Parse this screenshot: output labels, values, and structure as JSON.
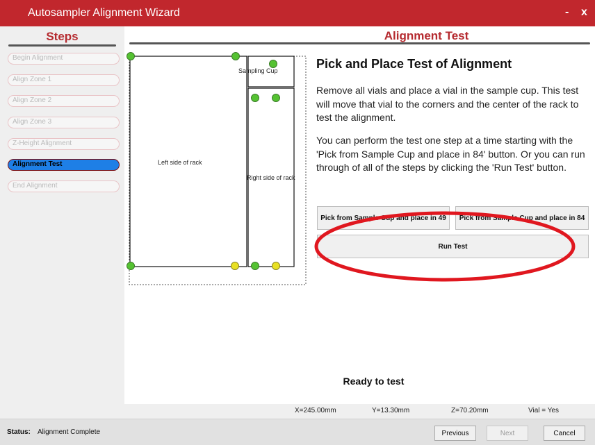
{
  "window": {
    "title": "Autosampler Alignment Wizard",
    "minimize_label": "-",
    "close_label": "x"
  },
  "sidebar": {
    "heading": "Steps",
    "items": [
      {
        "label": "Begin Alignment",
        "active": false
      },
      {
        "label": "Align Zone 1",
        "active": false
      },
      {
        "label": "Align Zone 2",
        "active": false
      },
      {
        "label": "Align Zone 3",
        "active": false
      },
      {
        "label": "Z-Height Alignment",
        "active": false
      },
      {
        "label": "Alignment Test",
        "active": true
      },
      {
        "label": "End Alignment",
        "active": false
      }
    ]
  },
  "main": {
    "heading": "Alignment Test",
    "rack": {
      "left_label": "Left side of rack",
      "right_label": "Right side of rack",
      "cup_label": "Sampling Cup",
      "marker_colors": {
        "green": "#55c232",
        "yellow": "#e8e023"
      }
    },
    "content_title": "Pick and Place Test of Alignment",
    "paragraph1": "Remove all vials and place a vial in the sample cup. This test will move that vial to the corners and the center of the rack to test the alignment.",
    "paragraph2": "You can perform the test one step at a time starting with the 'Pick from Sample Cup and place in 84' button. Or you can run through of all of the steps by clicking the 'Run Test' button.",
    "buttons": {
      "pick49": "Pick from Sample Cup and place in 49",
      "pick84": "Pick from Sample Cup and place in 84",
      "run_test": "Run Test"
    },
    "ready_text": "Ready to test",
    "highlight_color": "#e0171f"
  },
  "coords": {
    "x": "X=245.00mm",
    "y": "Y=13.30mm",
    "z": "Z=70.20mm",
    "vial": "Vial = Yes"
  },
  "status": {
    "label": "Status:",
    "value": "Alignment Complete",
    "previous": "Previous",
    "next": "Next",
    "cancel": "Cancel"
  },
  "colors": {
    "title_bar": "#c1272d",
    "heading": "#b52a2f",
    "active_step": "#1e7fe6"
  }
}
